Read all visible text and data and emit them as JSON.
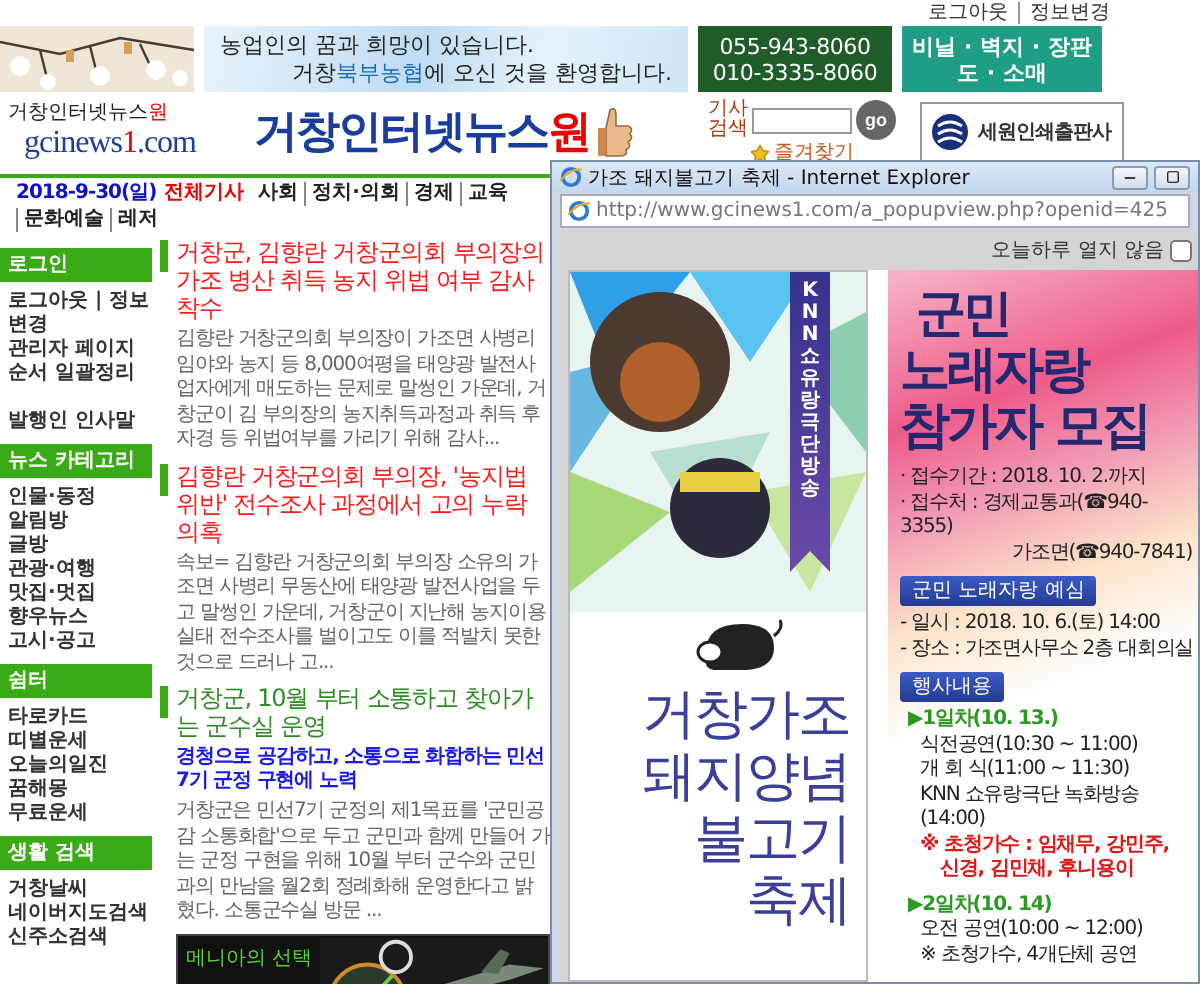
{
  "top_links": [
    "로그아웃",
    "정보변경"
  ],
  "greeting_banner": {
    "lines": [
      [
        {
          "text": "농업인의 꿈과 희망이 있습니다.",
          "accent": false
        }
      ],
      [
        {
          "text": "거창",
          "accent": false
        },
        {
          "text": "북부농협",
          "accent": true
        },
        {
          "text": "에 오신 것을 환영합니다.",
          "accent": false
        }
      ]
    ]
  },
  "phone_banner": {
    "lines": [
      "055-943-8060",
      "010-3335-8060"
    ]
  },
  "shop_banner": {
    "lines": [
      "비닐 · 벽지 · 장판",
      "도 · 소매"
    ]
  },
  "logo": {
    "top": [
      {
        "text": "거창인터넷뉴스",
        "accent": false
      },
      {
        "text": "원",
        "accent": true
      }
    ],
    "domain": [
      {
        "text": "gcinews",
        "accent": false
      },
      {
        "text": "1",
        "accent": true
      },
      {
        "text": ".com",
        "accent": false
      }
    ]
  },
  "site_title": [
    {
      "text": "거창인터넷뉴스",
      "accent": false
    },
    {
      "text": "원",
      "accent": true
    }
  ],
  "search": {
    "label_lines": [
      "기사",
      "검색"
    ],
    "button": "go",
    "favorites": "즐겨찾기"
  },
  "sponsor": {
    "name": "세원인쇄출판사"
  },
  "nav": {
    "date": "2018-9-30(일)",
    "all": "전체기사",
    "items": [
      "사회",
      "정치·의회",
      "경제",
      "교육",
      "문화예술",
      "레저"
    ]
  },
  "sidebar": [
    {
      "title": "로그인",
      "groups": [
        [
          "로그아웃 | 정보변경",
          "관리자 페이지",
          "순서 일괄정리"
        ],
        [
          "발행인 인사말"
        ]
      ]
    },
    {
      "title": "뉴스 카테고리",
      "groups": [
        [
          "인물·동정",
          "알림방",
          "글방",
          "관광·여행",
          "맛집·멋집",
          "향우뉴스",
          "고시·공고"
        ]
      ]
    },
    {
      "title": "쉼터",
      "groups": [
        [
          "타로카드",
          "띠별운세",
          "오늘의일진",
          "꿈해몽",
          "무료운세"
        ]
      ]
    },
    {
      "title": "생활 검색",
      "groups": [
        [
          "거창날씨",
          "네이버지도검색",
          "신주소검색"
        ]
      ]
    }
  ],
  "articles": [
    {
      "title": "거창군, 김향란 거창군의회 부의장의 가조 병산 취득 농지 위법 여부 감사 착수",
      "color": "#ff1a1a",
      "body": "김향란 거창군의회 부의장이 가조면 사병리 임야와 농지 등 8,000여평을 태양광 발전사업자에게 매도하는 문제로 말썽인 가운데, 거창군이 김 부의장의 농지취득과정과 취득 후 자경 등 위법여부를 가리기 위해 감사..."
    },
    {
      "title": "김향란 거창군의회 부의장, '농지법 위반' 전수조사 과정에서 고의 누락 의혹",
      "color": "#ff1a1a",
      "body": "속보= 김향란 거창군의회 부의장 소유의 가조면 사병리 무동산에 태양광  발전사업을 두고 말썽인 가운데, 거창군이 지난해 농지이용실태 전수조사를 벌이고도 이를 적발치 못한 것으로 드러나 고..."
    },
    {
      "title": "거창군, 10월 부터 소통하고 찾아가는 군수실 운영",
      "color": "#2e8b22",
      "subtitle": "경청으로 공감하고, 소통으로 화합하는 민선7기 군정 구현에 노력",
      "body": " 거창군은 민선7기 군정의 제1목표를 '군민공감 소통화합'으로 두고 군민과 함께 만들어 가는 군정 구현을 위해 10월 부터 군수와 군민과의 만남을 월2회 정례화해 운영한다고 밝혔다. 소통군수실 방문 ..."
    }
  ],
  "ad": {
    "text": "메니아의 선택"
  },
  "popup": {
    "title": "가조 돼지불고기 축제 - Internet Explorer",
    "url": "http://www.gcinews1.com/a_popupview.php?openid=425",
    "dismiss": {
      "label": "오늘하루 열지 않음",
      "checked": false
    },
    "poster_left": {
      "ribbon": "KNN 쇼유랑극단 방송",
      "headline": [
        "거창가조",
        "돼지양념",
        "불고기",
        "축제"
      ]
    },
    "poster_right": {
      "headline": [
        "군민",
        "노래자랑",
        "참가자 모집"
      ],
      "blocks": [
        {
          "kind": "info",
          "text": "· 접수기간 : 2018. 10. 2.까지"
        },
        {
          "kind": "info",
          "text": "· 접수처 : 경제교통과(☎940-3355)"
        },
        {
          "kind": "indent",
          "text": "가조면(☎940-7841)"
        },
        {
          "kind": "tag",
          "text": "군민 노래자랑 예심"
        },
        {
          "kind": "info",
          "text": "- 일시 : 2018. 10. 6.(토) 14:00"
        },
        {
          "kind": "info",
          "text": "- 장소 : 가조면사무소 2층 대회의실"
        },
        {
          "kind": "tag",
          "text": "행사내용"
        },
        {
          "kind": "day",
          "text": "▶1일차(10. 13.)"
        },
        {
          "kind": "item",
          "text": "식전공연(10:30 ~ 11:00)"
        },
        {
          "kind": "item",
          "text": "개 회 식(11:00 ~ 11:30)"
        },
        {
          "kind": "item",
          "text": "KNN 쇼유랑극단 녹화방송(14:00)"
        },
        {
          "kind": "guest",
          "text": "※ 초청가수 : 임채무, 강민주,"
        },
        {
          "kind": "guest-cont",
          "text": "신경, 김민채, 후니용이"
        },
        {
          "kind": "day",
          "text": "▶2일차(10. 14)"
        },
        {
          "kind": "item",
          "text": "오전 공연(10:00 ~ 12:00)"
        },
        {
          "kind": "item",
          "text": "※ 초청가수, 4개단체 공연"
        }
      ]
    }
  }
}
